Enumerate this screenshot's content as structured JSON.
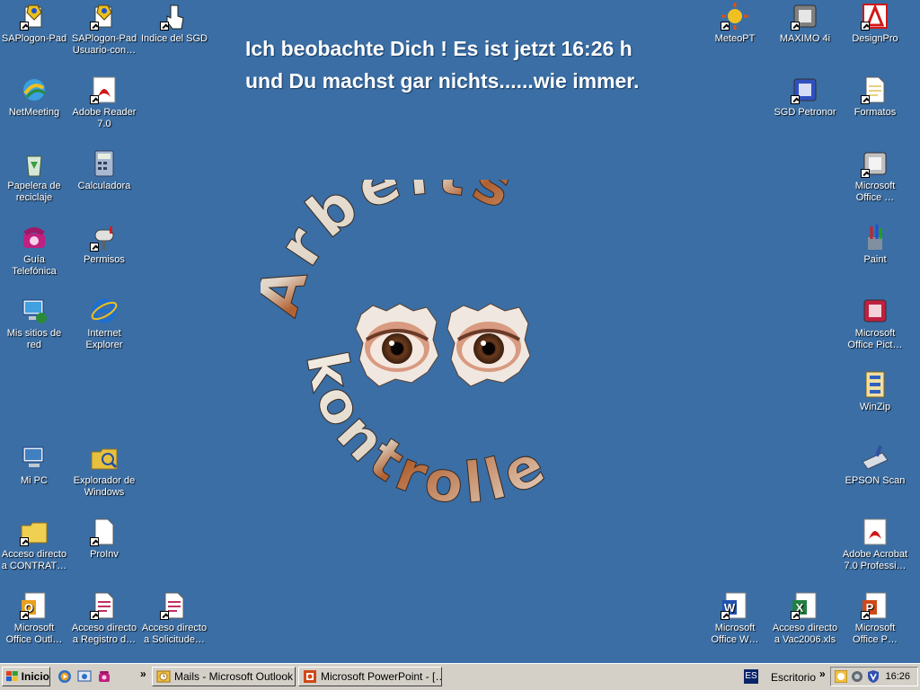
{
  "desktop": {
    "message": [
      "Ich beobachte Dich ! Es ist jetzt 16:26 h",
      "und Du machst gar nichts......wie immer."
    ],
    "wallpaper_text": {
      "top": "Arbeits",
      "bottom": "kontrolle"
    },
    "icons": [
      {
        "id": "saplogon-pad",
        "label": "SAPlogon-Pad",
        "icon": "sap-logon-icon",
        "color": "#e8c020"
      },
      {
        "id": "saplogon-pad-usuario",
        "label": "SAPlogon-Pad Usuario-con…",
        "icon": "sap-logon-icon",
        "color": "#e8c020"
      },
      {
        "id": "indice-sgd",
        "label": "Indice del SGD",
        "icon": "pointer-hand-icon",
        "color": "#ffffff"
      },
      {
        "id": "netmeeting",
        "label": "NetMeeting",
        "icon": "netmeeting-icon",
        "color": "#2a8a3a"
      },
      {
        "id": "adobe-reader",
        "label": "Adobe Reader 7.0",
        "icon": "adobe-reader-icon",
        "color": "#d01818"
      },
      {
        "id": "papelera",
        "label": "Papelera de reciclaje",
        "icon": "recycle-bin-icon",
        "color": "#3aa040"
      },
      {
        "id": "calculadora",
        "label": "Calculadora",
        "icon": "calculator-icon",
        "color": "#a8b8d0"
      },
      {
        "id": "guia-telefonica",
        "label": "Guía Telefónica",
        "icon": "telephone-icon",
        "color": "#c02080"
      },
      {
        "id": "permisos",
        "label": "Permisos",
        "icon": "mailbox-icon",
        "color": "#808080"
      },
      {
        "id": "mis-sitios",
        "label": "Mis sitios de red",
        "icon": "network-places-icon",
        "color": "#40a0e0"
      },
      {
        "id": "internet-explorer",
        "label": "Internet Explorer",
        "icon": "internet-explorer-icon",
        "color": "#1e6fd0"
      },
      {
        "id": "mi-pc",
        "label": "Mi PC",
        "icon": "my-computer-icon",
        "color": "#4080c0"
      },
      {
        "id": "explorador",
        "label": "Explorador de Windows",
        "icon": "windows-explorer-icon",
        "color": "#e8c040"
      },
      {
        "id": "acceso-contrat",
        "label": "Acceso directo a CONTRAT…",
        "icon": "folder-icon",
        "color": "#f0d050"
      },
      {
        "id": "proinv",
        "label": "ProInv",
        "icon": "proinv-icon",
        "color": "#ffffff"
      },
      {
        "id": "office-outlook",
        "label": "Microsoft Office Outl…",
        "icon": "outlook-icon",
        "color": "#e8a020"
      },
      {
        "id": "registro",
        "label": "Acceso directo a Registro d…",
        "icon": "document-icon",
        "color": "#c03060"
      },
      {
        "id": "solicitude",
        "label": "Acceso directo a Solicitude…",
        "icon": "document-icon",
        "color": "#c03060"
      },
      {
        "id": "meteopt",
        "label": "MeteoPT",
        "icon": "sun-icon",
        "color": "#f0c020"
      },
      {
        "id": "maximo",
        "label": "MAXIMO 4i",
        "icon": "maximo-icon",
        "color": "#808080"
      },
      {
        "id": "designpro",
        "label": "DesignPro",
        "icon": "designpro-icon",
        "color": "#d01818"
      },
      {
        "id": "sgd-petronor",
        "label": "SGD Petronor",
        "icon": "sgd-icon",
        "color": "#3050c0"
      },
      {
        "id": "formatos",
        "label": "Formatos",
        "icon": "formatos-icon",
        "color": "#e8d080"
      },
      {
        "id": "office-tools",
        "label": "Microsoft Office …",
        "icon": "office-tools-icon",
        "color": "#c0c0c0"
      },
      {
        "id": "paint",
        "label": "Paint",
        "icon": "paint-icon",
        "color": "#e04040"
      },
      {
        "id": "office-picture",
        "label": "Microsoft Office Pict…",
        "icon": "picture-manager-icon",
        "color": "#c02040"
      },
      {
        "id": "winzip",
        "label": "WinZip",
        "icon": "winzip-icon",
        "color": "#3060c0"
      },
      {
        "id": "epson-scan",
        "label": "EPSON Scan",
        "icon": "scanner-icon",
        "color": "#3050a0"
      },
      {
        "id": "acrobat",
        "label": "Adobe Acrobat 7.0 Professi…",
        "icon": "acrobat-icon",
        "color": "#d01818"
      },
      {
        "id": "office-word",
        "label": "Microsoft Office W…",
        "icon": "word-icon",
        "color": "#2050b0"
      },
      {
        "id": "vac2006",
        "label": "Acceso directo a Vac2006.xls",
        "icon": "excel-icon",
        "color": "#208040"
      },
      {
        "id": "office-ppt",
        "label": "Microsoft Office P…",
        "icon": "powerpoint-icon",
        "color": "#d04818"
      }
    ]
  },
  "taskbar": {
    "start_label": "Inicio",
    "chevron": "»",
    "tasks": [
      {
        "label": "Mails - Microsoft Outlook",
        "icon": "outlook-icon"
      },
      {
        "label": "Microsoft PowerPoint - […",
        "icon": "powerpoint-icon"
      }
    ],
    "language": "ES",
    "desktop_label": "Escritorio",
    "clock": "16:26"
  }
}
